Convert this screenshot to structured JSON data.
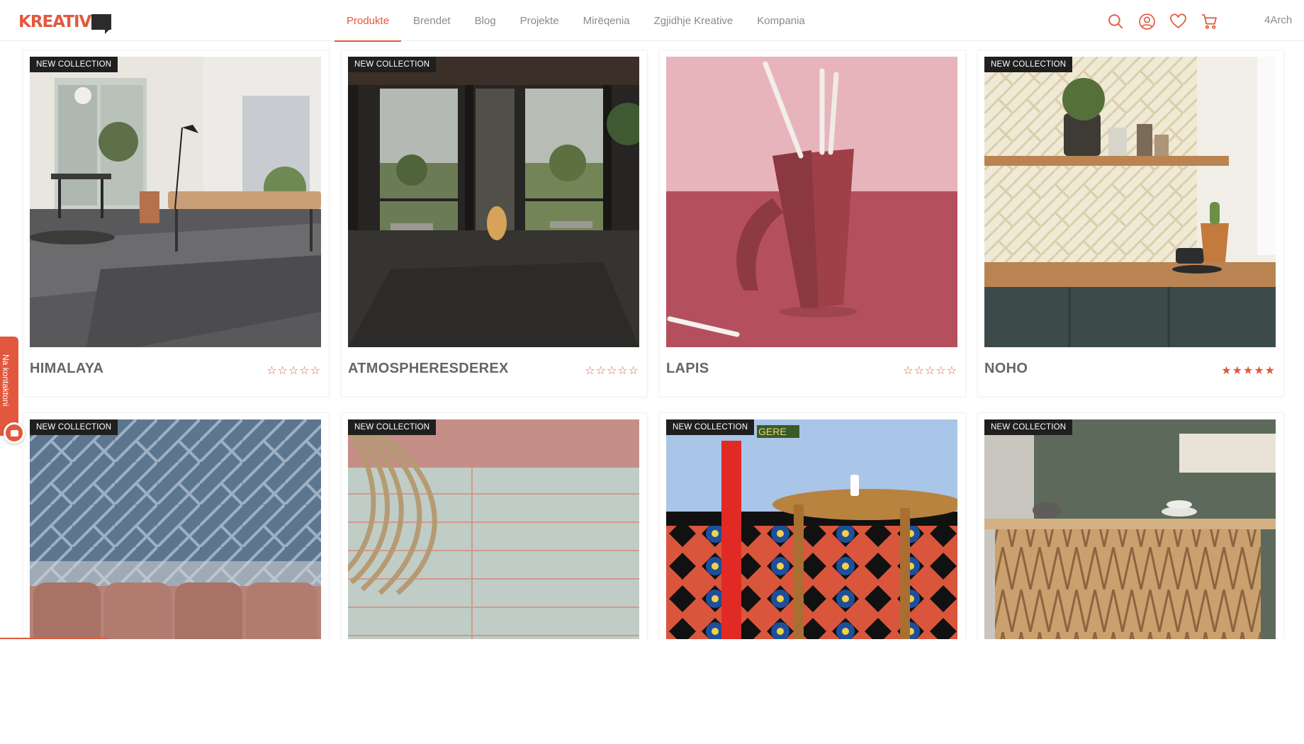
{
  "header": {
    "logo_text": "KREATIV",
    "nav": [
      "Produkte",
      "Brendet",
      "Blog",
      "Projekte",
      "Mirëqenia",
      "Zgjidhje Kreative",
      "Kompania"
    ],
    "active_nav": "Produkte",
    "icons": [
      "search-icon",
      "user-icon",
      "heart-icon",
      "cart-icon"
    ],
    "account_name": "4Arch"
  },
  "products": [
    {
      "badge": "NEW COLLECTION",
      "name": "HIMALAYA",
      "rating": 0,
      "stars": "☆☆☆☆☆"
    },
    {
      "badge": "NEW COLLECTION",
      "name": "ATMOSPHERESDEREX",
      "rating": 0,
      "stars": "☆☆☆☆☆"
    },
    {
      "badge": "",
      "name": "LAPIS",
      "rating": 0,
      "stars": "☆☆☆☆☆"
    },
    {
      "badge": "NEW COLLECTION",
      "name": "NOHO",
      "rating": 5,
      "stars": "★★★★★"
    },
    {
      "badge": "NEW COLLECTION"
    },
    {
      "badge": "NEW COLLECTION"
    },
    {
      "badge": "NEW COLLECTION",
      "sign_text": "GERE"
    },
    {
      "badge": "NEW COLLECTION"
    }
  ],
  "contact_tab": {
    "label": "Na kontaktoni"
  },
  "colors": {
    "accent": "#e2583e",
    "text_muted": "#8a8a8a",
    "badge_bg": "#1f1f1f"
  }
}
